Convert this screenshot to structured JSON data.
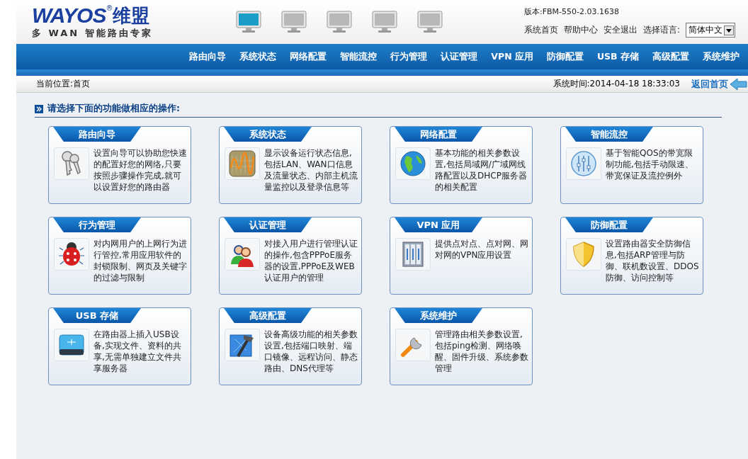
{
  "logo": {
    "brand": "WAYOS",
    "mark": "®",
    "brand_cn": "维盟",
    "tagline": "多 WAN 智能路由专家"
  },
  "monitors": [
    {
      "selected": true
    },
    {
      "selected": false
    },
    {
      "selected": false
    },
    {
      "selected": false
    },
    {
      "selected": false
    }
  ],
  "version": "版本:FBM-550-2.03.1638",
  "top_links": [
    "系统首页",
    "帮助中心",
    "安全退出"
  ],
  "language": {
    "label": "选择语言:",
    "value": "简体中文"
  },
  "nav": [
    "路由向导",
    "系统状态",
    "网络配置",
    "智能流控",
    "行为管理",
    "认证管理",
    "VPN 应用",
    "防御配置",
    "USB 存储",
    "高级配置",
    "系统维护"
  ],
  "breadcrumb": "当前位置:首页",
  "system_time": "系统时间:2014-04-18 18:33:03",
  "back_link": "返回首页",
  "section_title": "请选择下面的功能做相应的操作:",
  "cards": [
    {
      "title": "路由向导",
      "description": "设置向导可以协助您快速的配置好您的网络,只要按照步骤操作完成,就可以设置好您的路由器"
    },
    {
      "title": "系统状态",
      "description": "显示设备运行状态信息,包括LAN、WAN口信息及流量状态、内部主机流量监控以及登录信息等"
    },
    {
      "title": "网络配置",
      "description": "基本功能的相关参数设置,包括局域网/广域网线路配置以及DHCP服务器的相关配置"
    },
    {
      "title": "智能流控",
      "description": "基于智能QOS的带宽限制功能,包括手动限速、带宽保证及流控例外"
    },
    {
      "title": "行为管理",
      "description": "对内网用户的上网行为进行管控,常用应用软件的封锁限制、网页及关键字的过滤与限制"
    },
    {
      "title": "认证管理",
      "description": "对接入用户进行管理认证的操作,包含PPPoE服务器的设置,PPPoE及WEB认证用户的管理"
    },
    {
      "title": "VPN 应用",
      "description": "提供点对点、点对网、网对网的VPN应用设置"
    },
    {
      "title": "防御配置",
      "description": "设置路由器安全防御信息,包括ARP管理与防御、联机数设置、DDOS防御、访问控制等"
    },
    {
      "title": "USB 存储",
      "description": "在路由器上插入USB设备,实现文件、资料的共享,无需单独建立文件共享服务器"
    },
    {
      "title": "高级配置",
      "description": "设备高级功能的相关参数设置,包括端口映射、端口镜像、远程访问、静态路由、DNS代理等"
    },
    {
      "title": "系统维护",
      "description": "管理路由相关参数设置,包括ping检测、网络唤醒、固件升级、系统参数管理"
    }
  ]
}
